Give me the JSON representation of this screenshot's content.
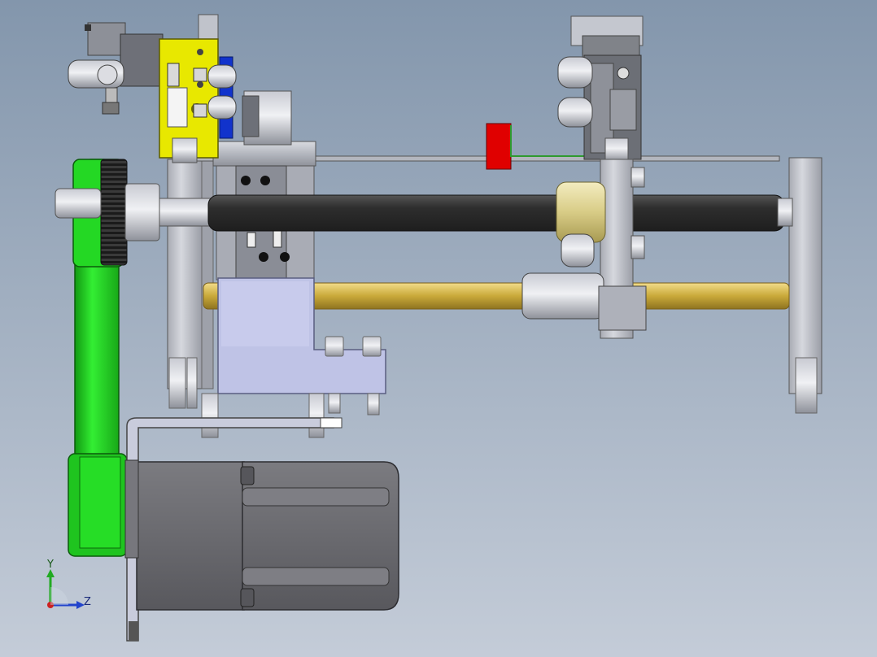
{
  "viewport": {
    "background_top": "#8396ac",
    "background_bottom": "#c4ccd8"
  },
  "part_colors": {
    "drive_belt": "#22dd22",
    "yellow_bracket": "#e6e600",
    "blue_plate": "#1133cc",
    "red_block": "#e00000",
    "guide_rod": "#d4b84a",
    "roller_shaft": "#3b3b3b",
    "motor_body": "#6d6d72",
    "mounting_block": "#b8bce0",
    "frame_steel": "#b9bcc4"
  },
  "triad": {
    "y_label": "Y",
    "z_label": "Z",
    "y_color": "#22aa22",
    "z_color": "#2244cc",
    "x_color": "#cc2222"
  }
}
